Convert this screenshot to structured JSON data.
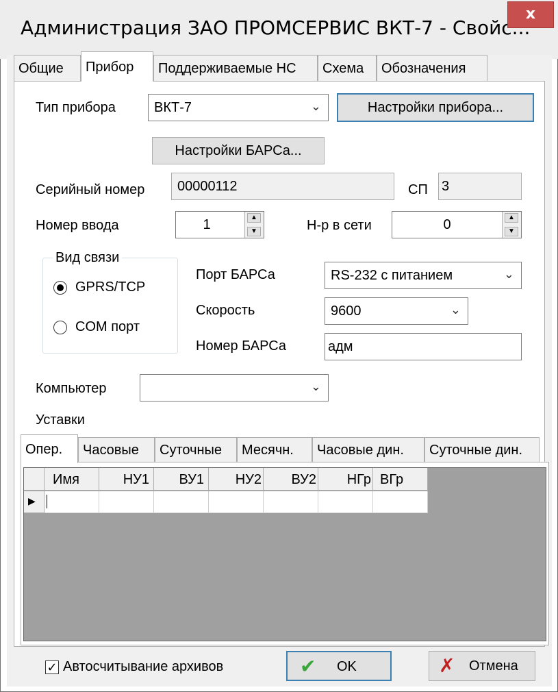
{
  "window": {
    "title": "Администрация ЗАО ПРОМСЕРВИС ВКТ-7 - Свойс...",
    "close_label": "x"
  },
  "tabs": [
    {
      "label": "Общие"
    },
    {
      "label": "Прибор"
    },
    {
      "label": "Поддерживаемые НС"
    },
    {
      "label": "Схема"
    },
    {
      "label": "Обозначения"
    }
  ],
  "device": {
    "type_label": "Тип прибора",
    "type_value": "ВКТ-7",
    "settings_button": "Настройки прибора...",
    "bars_settings_button": "Настройки БАРСа...",
    "serial_label": "Серийный номер",
    "serial_value": "00000112",
    "sp_label": "СП",
    "sp_value": "3",
    "input_no_label": "Номер ввода",
    "input_no_value": "1",
    "net_no_label": "Н-р в сети",
    "net_no_value": "0"
  },
  "connection": {
    "group_title": "Вид связи",
    "options": [
      {
        "label": "GPRS/TCP",
        "selected": true
      },
      {
        "label": "COM порт",
        "selected": false
      }
    ],
    "port_label": "Порт БАРСа",
    "port_value": "RS-232 с питанием",
    "speed_label": "Скорость",
    "speed_value": "9600",
    "bars_no_label": "Номер БАРСа",
    "bars_no_value": "адм"
  },
  "computer": {
    "label": "Компьютер",
    "value": ""
  },
  "setpoints": {
    "label": "Уставки",
    "tabs": [
      {
        "label": "Опер."
      },
      {
        "label": "Часовые"
      },
      {
        "label": "Суточные"
      },
      {
        "label": "Месячн."
      },
      {
        "label": "Часовые дин."
      },
      {
        "label": "Суточные дин."
      }
    ],
    "columns": [
      "Имя",
      "НУ1",
      "ВУ1",
      "НУ2",
      "ВУ2",
      "НГр",
      "ВГр"
    ],
    "row_indicator": "▶"
  },
  "footer": {
    "autoread_label": "Автосчитывание архивов",
    "autoread_checked": true,
    "ok_label": "OK",
    "cancel_label": "Отмена"
  }
}
